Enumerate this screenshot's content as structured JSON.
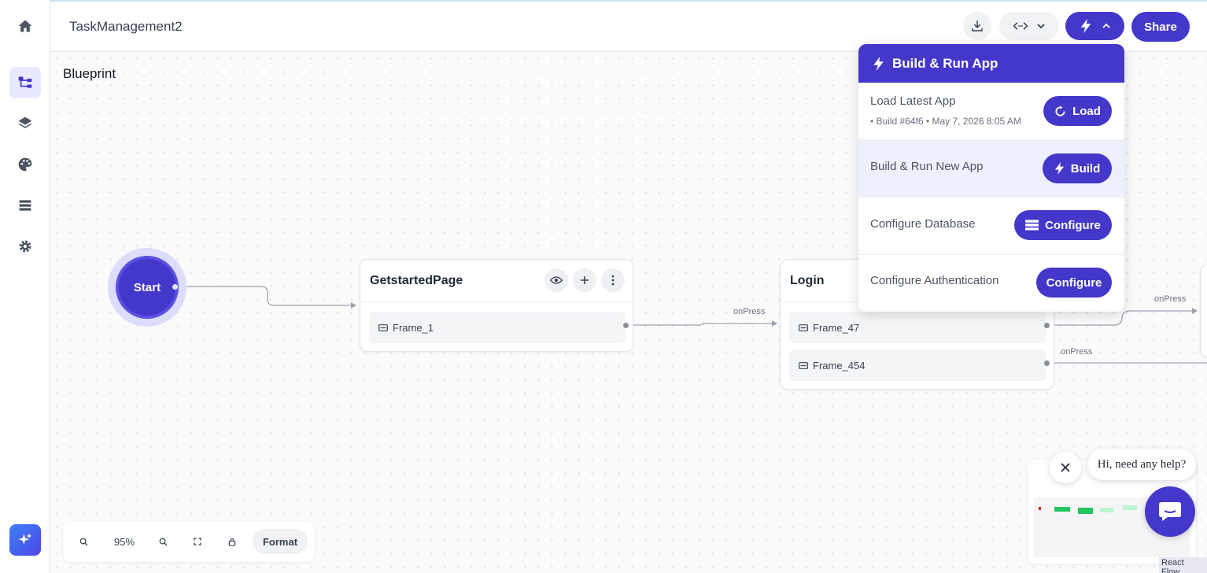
{
  "header": {
    "project_title": "TaskManagement2",
    "share_label": "Share"
  },
  "canvas": {
    "title": "Blueprint",
    "start_label": "Start",
    "nodes": [
      {
        "title": "GetstartedPage",
        "frames": [
          "Frame_1"
        ]
      },
      {
        "title": "Login",
        "frames": [
          "Frame_47",
          "Frame_454"
        ]
      }
    ],
    "edge_labels": [
      "onPress",
      "onPress",
      "onPress"
    ]
  },
  "controls": {
    "zoom": "95%",
    "format_label": "Format"
  },
  "dropdown": {
    "title": "Build & Run App",
    "rows": [
      {
        "label": "Load Latest App",
        "sub": "• Build #64f6   • May 7, 2026 8:05 AM",
        "button": "Load"
      },
      {
        "label": "Build & Run New App",
        "button": "Build"
      },
      {
        "label": "Configure Database",
        "button": "Configure"
      },
      {
        "label": "Configure Authentication",
        "button": "Configure"
      }
    ]
  },
  "chat": {
    "message": "Hi, need any help?"
  },
  "minimap": {
    "attribution": "React Flow"
  },
  "colors": {
    "accent": "#4338ca",
    "accent_light": "#dcdcfb"
  }
}
